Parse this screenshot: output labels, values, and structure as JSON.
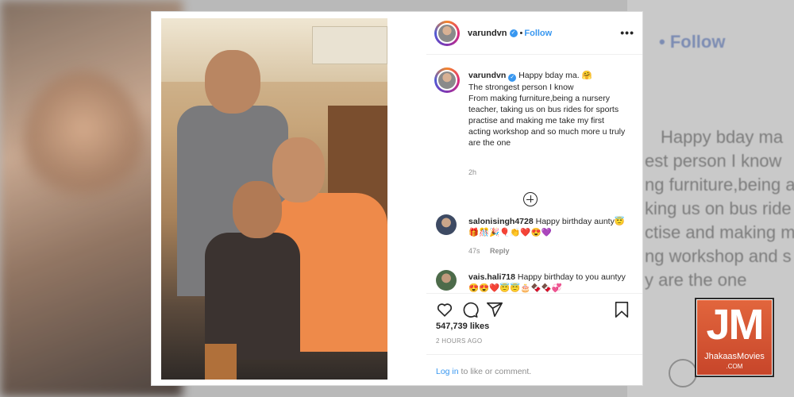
{
  "backdrop": {
    "follow_text": "• Follow",
    "lines": [
      "Happy bday ma",
      "est person I know",
      "ng furniture,being a",
      "king us on bus ride",
      "ctise and making m",
      "ng workshop and s",
      "y are the one"
    ]
  },
  "post": {
    "header": {
      "username": "varundvn",
      "separator": "•",
      "follow_label": "Follow",
      "more_label": "•••"
    },
    "caption": {
      "username": "varundvn",
      "text": "Happy bday ma. 🤗\nThe strongest person I know\nFrom making furniture,being a nursery teacher, taking us on bus rides for sports practise and making me take my first acting workshop and so much more u truly are the one",
      "time": "2h"
    },
    "comments": [
      {
        "username": "salonisingh4728",
        "text": "Happy birthday aunty😇🎁🎊🎉🎈👏❤️😍💜",
        "time": "47s",
        "reply_label": "Reply"
      },
      {
        "username": "vais.hali718",
        "text": "Happy birthday to you auntyy😍😍❤️😇😇🎂🍫🍫💞",
        "time": "",
        "reply_label": ""
      }
    ],
    "likes": "547,739 likes",
    "posted_ago": "2 HOURS AGO",
    "login_link": "Log in",
    "login_rest": " to like or comment."
  },
  "watermark": {
    "logo_letters": "JM",
    "site": "JhakaasMovies",
    "tld": ".COM"
  },
  "colors": {
    "accent": "#3897f0",
    "text": "#262626",
    "muted": "#8e8e8e",
    "logo_bg": "#d4552f"
  },
  "icons": [
    "more-icon",
    "verified-icon",
    "load-more-icon",
    "heart-icon",
    "comment-icon",
    "share-icon",
    "bookmark-icon"
  ]
}
